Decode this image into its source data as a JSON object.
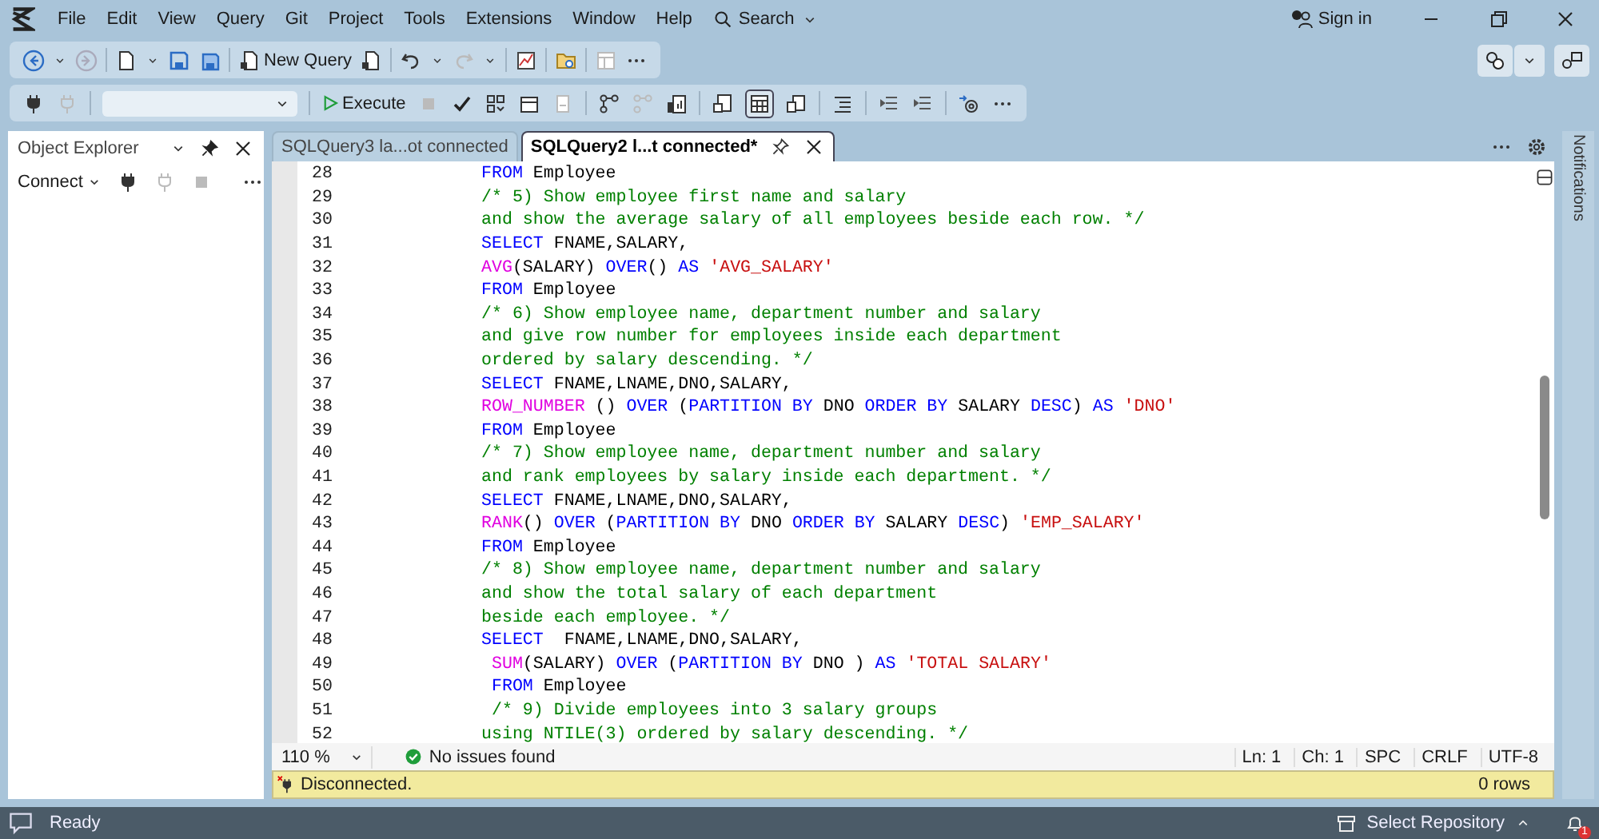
{
  "menu": [
    {
      "label": "File"
    },
    {
      "label": "Edit"
    },
    {
      "label": "View"
    },
    {
      "label": "Query"
    },
    {
      "label": "Git"
    },
    {
      "label": "Project"
    },
    {
      "label": "Tools"
    },
    {
      "label": "Extensions"
    },
    {
      "label": "Window"
    },
    {
      "label": "Help"
    }
  ],
  "search": "Search",
  "account": "Sign in",
  "toolbar": {
    "new_query": "New Query",
    "execute": "Execute"
  },
  "object_explorer": {
    "title": "Object Explorer",
    "connect": "Connect"
  },
  "tabs": [
    {
      "label": "SQLQuery3 la...ot connected",
      "selected": false
    },
    {
      "label": "SQLQuery2 l...t connected*",
      "selected": true
    }
  ],
  "editor": {
    "lines": [
      {
        "number": "28",
        "tokens": [
          {
            "kind": "keyword",
            "text": "FROM"
          },
          {
            "kind": "plain",
            "text": " Employee"
          }
        ]
      },
      {
        "number": "29",
        "tokens": [
          {
            "kind": "comment",
            "text": "/* 5) Show employee first name and salary"
          }
        ]
      },
      {
        "number": "30",
        "tokens": [
          {
            "kind": "comment",
            "text": "and show the average salary of all employees beside each row. */"
          }
        ]
      },
      {
        "number": "31",
        "tokens": [
          {
            "kind": "keyword",
            "text": "SELECT"
          },
          {
            "kind": "plain",
            "text": " FNAME,SALARY,"
          }
        ]
      },
      {
        "number": "32",
        "tokens": [
          {
            "kind": "function",
            "text": "AVG"
          },
          {
            "kind": "plain",
            "text": "(SALARY) "
          },
          {
            "kind": "keyword",
            "text": "OVER"
          },
          {
            "kind": "plain",
            "text": "() "
          },
          {
            "kind": "keyword",
            "text": "AS"
          },
          {
            "kind": "string",
            "text": " 'AVG_SALARY'"
          }
        ]
      },
      {
        "number": "33",
        "tokens": [
          {
            "kind": "keyword",
            "text": "FROM"
          },
          {
            "kind": "plain",
            "text": " Employee"
          }
        ]
      },
      {
        "number": "34",
        "tokens": [
          {
            "kind": "comment",
            "text": "/* 6) Show employee name, department number and salary"
          }
        ]
      },
      {
        "number": "35",
        "tokens": [
          {
            "kind": "comment",
            "text": "and give row number for employees inside each department"
          }
        ]
      },
      {
        "number": "36",
        "tokens": [
          {
            "kind": "comment",
            "text": "ordered by salary descending. */"
          }
        ]
      },
      {
        "number": "37",
        "tokens": [
          {
            "kind": "keyword",
            "text": "SELECT"
          },
          {
            "kind": "plain",
            "text": " FNAME,LNAME,DNO,SALARY,"
          }
        ]
      },
      {
        "number": "38",
        "tokens": [
          {
            "kind": "function",
            "text": "ROW_NUMBER"
          },
          {
            "kind": "plain",
            "text": " () "
          },
          {
            "kind": "keyword",
            "text": "OVER"
          },
          {
            "kind": "plain",
            "text": " ("
          },
          {
            "kind": "keyword",
            "text": "PARTITION BY"
          },
          {
            "kind": "plain",
            "text": " DNO "
          },
          {
            "kind": "keyword",
            "text": "ORDER BY"
          },
          {
            "kind": "plain",
            "text": " SALARY "
          },
          {
            "kind": "keyword",
            "text": "DESC"
          },
          {
            "kind": "plain",
            "text": ") "
          },
          {
            "kind": "keyword",
            "text": "AS"
          },
          {
            "kind": "string",
            "text": " 'DNO'"
          }
        ]
      },
      {
        "number": "39",
        "tokens": [
          {
            "kind": "keyword",
            "text": "FROM"
          },
          {
            "kind": "plain",
            "text": " Employee"
          }
        ]
      },
      {
        "number": "40",
        "tokens": [
          {
            "kind": "comment",
            "text": "/* 7) Show employee name, department number and salary"
          }
        ]
      },
      {
        "number": "41",
        "tokens": [
          {
            "kind": "comment",
            "text": "and rank employees by salary inside each department. */"
          }
        ]
      },
      {
        "number": "42",
        "tokens": [
          {
            "kind": "keyword",
            "text": "SELECT"
          },
          {
            "kind": "plain",
            "text": " FNAME,LNAME,DNO,SALARY,"
          }
        ]
      },
      {
        "number": "43",
        "tokens": [
          {
            "kind": "function",
            "text": "RANK"
          },
          {
            "kind": "plain",
            "text": "() "
          },
          {
            "kind": "keyword",
            "text": "OVER"
          },
          {
            "kind": "plain",
            "text": " ("
          },
          {
            "kind": "keyword",
            "text": "PARTITION BY"
          },
          {
            "kind": "plain",
            "text": " DNO "
          },
          {
            "kind": "keyword",
            "text": "ORDER BY"
          },
          {
            "kind": "plain",
            "text": " SALARY "
          },
          {
            "kind": "keyword",
            "text": "DESC"
          },
          {
            "kind": "plain",
            "text": ") "
          },
          {
            "kind": "string",
            "text": "'EMP_SALARY'"
          }
        ]
      },
      {
        "number": "44",
        "tokens": [
          {
            "kind": "keyword",
            "text": "FROM"
          },
          {
            "kind": "plain",
            "text": " Employee"
          }
        ]
      },
      {
        "number": "45",
        "tokens": [
          {
            "kind": "comment",
            "text": "/* 8) Show employee name, department number and salary"
          }
        ]
      },
      {
        "number": "46",
        "tokens": [
          {
            "kind": "comment",
            "text": "and show the total salary of each department"
          }
        ]
      },
      {
        "number": "47",
        "tokens": [
          {
            "kind": "comment",
            "text": "beside each employee. */"
          }
        ]
      },
      {
        "number": "48",
        "tokens": [
          {
            "kind": "keyword",
            "text": "SELECT"
          },
          {
            "kind": "plain",
            "text": "  FNAME,LNAME,DNO,SALARY,"
          }
        ]
      },
      {
        "number": "49",
        "tokens": [
          {
            "kind": "function",
            "text": " SUM"
          },
          {
            "kind": "plain",
            "text": "(SALARY) "
          },
          {
            "kind": "keyword",
            "text": "OVER"
          },
          {
            "kind": "plain",
            "text": " ("
          },
          {
            "kind": "keyword",
            "text": "PARTITION BY"
          },
          {
            "kind": "plain",
            "text": " DNO ) "
          },
          {
            "kind": "keyword",
            "text": "AS"
          },
          {
            "kind": "string",
            "text": " 'TOTAL SALARY'"
          }
        ]
      },
      {
        "number": "50",
        "tokens": [
          {
            "kind": "keyword",
            "text": " FROM"
          },
          {
            "kind": "plain",
            "text": " Employee"
          }
        ]
      },
      {
        "number": "51",
        "tokens": [
          {
            "kind": "comment",
            "text": " /* 9) Divide employees into 3 salary groups"
          }
        ]
      },
      {
        "number": "52",
        "tokens": [
          {
            "kind": "comment",
            "text": "using NTILE(3) ordered by salary descending. */"
          }
        ]
      }
    ]
  },
  "editor_status": {
    "zoom": "110 %",
    "issues": "No issues found",
    "fields": [
      "Ln: 1",
      "Ch: 1",
      "SPC",
      "CRLF",
      "UTF-8"
    ]
  },
  "connection_bar": {
    "status": "Disconnected.",
    "rows": "0 rows"
  },
  "notifications_label": "Notifications",
  "status_bar": {
    "text": "Ready",
    "repository": "Select Repository",
    "notification_count": "1"
  }
}
